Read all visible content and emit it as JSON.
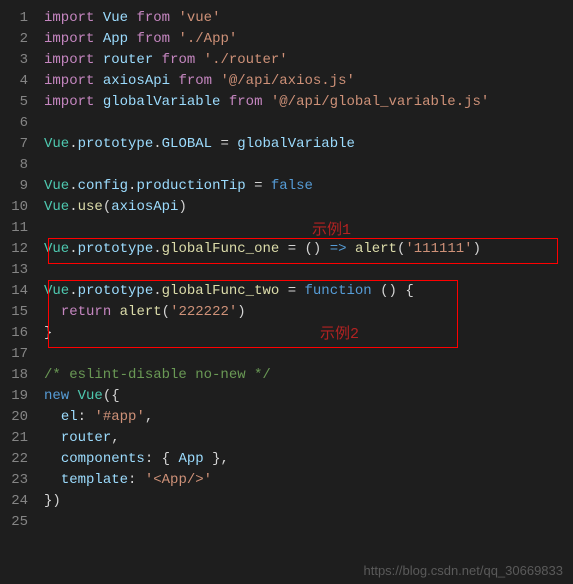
{
  "gutter": {
    "start": 1,
    "end": 25
  },
  "code": {
    "l1": {
      "kw1": "import",
      "id": "Vue",
      "kw2": "from",
      "str": "'vue'"
    },
    "l2": {
      "kw1": "import",
      "id": "App",
      "kw2": "from",
      "str": "'./App'"
    },
    "l3": {
      "kw1": "import",
      "id": "router",
      "kw2": "from",
      "str": "'./router'"
    },
    "l4": {
      "kw1": "import",
      "id": "axiosApi",
      "kw2": "from",
      "str": "'@/api/axios.js'"
    },
    "l5": {
      "kw1": "import",
      "id": "globalVariable",
      "kw2": "from",
      "str": "'@/api/global_variable.js'"
    },
    "l7": {
      "obj": "Vue",
      "dot": ".",
      "p1": "prototype",
      "p2": "GLOBAL",
      "eq": " = ",
      "val": "globalVariable"
    },
    "l9": {
      "obj": "Vue",
      "p1": "config",
      "p2": "productionTip",
      "eq": " = ",
      "val": "false"
    },
    "l10": {
      "obj": "Vue",
      "m": "use",
      "arg": "axiosApi"
    },
    "l12": {
      "obj": "Vue",
      "p1": "prototype",
      "fn": "globalFunc_one",
      "arrow": "=>",
      "call": "alert",
      "arg": "'111111'"
    },
    "l14": {
      "obj": "Vue",
      "p1": "prototype",
      "fn": "globalFunc_two",
      "kw": "function"
    },
    "l15": {
      "kw": "return",
      "call": "alert",
      "arg": "'222222'"
    },
    "l16": {
      "brace": "}"
    },
    "l18": {
      "comment": "/* eslint-disable no-new */"
    },
    "l19": {
      "kw": "new",
      "cls": "Vue",
      "open": "({"
    },
    "l20": {
      "key": "el",
      "val": "'#app'",
      "comma": ","
    },
    "l21": {
      "key": "router",
      "comma": ","
    },
    "l22": {
      "key": "components",
      "open": "{ ",
      "id": "App",
      "close": " }",
      "comma": ","
    },
    "l23": {
      "key": "template",
      "val": "'<App/>'"
    },
    "l24": {
      "close": "})"
    }
  },
  "annotations": {
    "label1": "示例1",
    "label2": "示例2"
  },
  "watermark": "https://blog.csdn.net/qq_30669833"
}
